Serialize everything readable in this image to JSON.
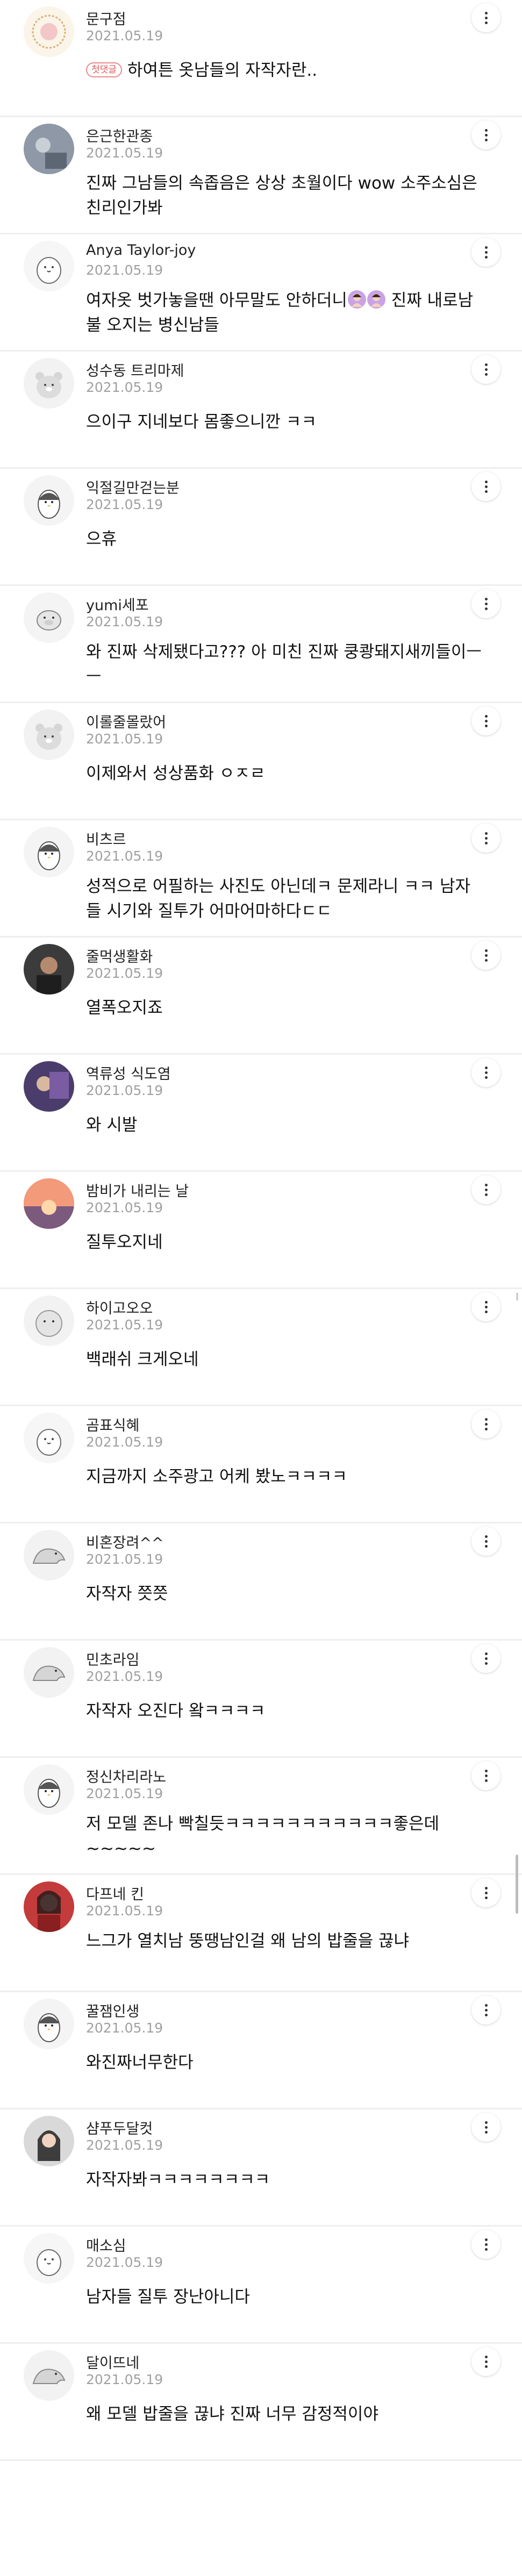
{
  "comments": [
    {
      "author": "문구점",
      "date": "2021.05.19",
      "badge": "첫댓글",
      "text": "하여튼 옷남들의 자작자란..",
      "avatar": "logo-avatar"
    },
    {
      "author": "은근한관종",
      "date": "2021.05.19",
      "text": "진짜 그남들의 속좁음은 상상 초월이다 wow 소주소심은 친리인가봐",
      "avatar": "photo-avatar"
    },
    {
      "author": "Anya Taylor-joy",
      "date": "2021.05.19",
      "text": "여자옷 벗가놓을땐 아무말도 안하더니",
      "text_after": " 진짜 내로남불 오지는 병신남들",
      "avatar": "default-avatar",
      "emoji": [
        "woman-emoji",
        "woman-emoji"
      ]
    },
    {
      "author": "성수동 트리마제",
      "date": "2021.05.19",
      "text": "으이구 지네보다 몸좋으니깐 ㅋㅋ",
      "avatar": "bear-avatar"
    },
    {
      "author": "익절길만걷는분",
      "date": "2021.05.19",
      "text": "으휴",
      "avatar": "penguin-avatar"
    },
    {
      "author": "yumi세포",
      "date": "2021.05.19",
      "text": "와 진짜 삭제됐다고??? 아 미친 진짜 쿵쾅돼지새끼들이ㅡㅡ",
      "avatar": "pig-avatar"
    },
    {
      "author": "이롤줄몰랐어",
      "date": "2021.05.19",
      "text": "이제와서 성상품화 ㅇㅈㄹ",
      "avatar": "bear-avatar"
    },
    {
      "author": "비츠르",
      "date": "2021.05.19",
      "text": "성적으로 어필하는 사진도 아닌데ㅋ 문제라니 ㅋㅋ 남자들 시기와 질투가 어마어마하다ㄷㄷ",
      "avatar": "penguin-avatar"
    },
    {
      "author": "줄먹생활화",
      "date": "2021.05.19",
      "text": "열폭오지죠",
      "avatar": "photo-avatar-dark"
    },
    {
      "author": "역류성 식도염",
      "date": "2021.05.19",
      "text": "와 시발",
      "avatar": "photo-avatar-purple"
    },
    {
      "author": "밤비가 내리는 날",
      "date": "2021.05.19",
      "text": "질투오지네",
      "avatar": "sunset-avatar"
    },
    {
      "author": "하이고오오",
      "date": "2021.05.19",
      "text": "백래쉬 크게오네",
      "avatar": "round-avatar"
    },
    {
      "author": "곰표식혜",
      "date": "2021.05.19",
      "text": "지금까지 소주광고 어케 봤노ㅋㅋㅋㅋ",
      "avatar": "default-avatar"
    },
    {
      "author": "비혼장려^^",
      "date": "2021.05.19",
      "text": "자작자 쯧쯧",
      "avatar": "dino-avatar"
    },
    {
      "author": "민초라임",
      "date": "2021.05.19",
      "text": "자작자 오진다 왘ㅋㅋㅋㅋ",
      "avatar": "dino-avatar"
    },
    {
      "author": "정신차리라노",
      "date": "2021.05.19",
      "text": "저 모델 존나 빡칠듯ㅋㅋㅋㅋㅋㅋㅋㅋㅋㅋㅋ좋은데~~~~~",
      "avatar": "penguin-avatar"
    },
    {
      "author": "다프네 킨",
      "date": "2021.05.19",
      "text": "느그가 열치남 뚱땡남인걸 왜 남의 밥줄을 끊냐",
      "avatar": "photo-avatar-red"
    },
    {
      "author": "꿀잼인생",
      "date": "2021.05.19",
      "text": "와진짜너무한다",
      "avatar": "penguin-avatar"
    },
    {
      "author": "샴푸두달컷",
      "date": "2021.05.19",
      "text": "자작자봐ㅋㅋㅋㅋㅋㅋㅋㅋ",
      "avatar": "photo-avatar-woman"
    },
    {
      "author": "매소심",
      "date": "2021.05.19",
      "text": "남자들 질투 장난아니다",
      "avatar": "default-avatar"
    },
    {
      "author": "달이뜨네",
      "date": "2021.05.19",
      "text": "왜 모델 밥줄을 끊냐 진짜 너무 감정적이야",
      "avatar": "dino-avatar"
    }
  ],
  "more_button": {
    "label": "⋮",
    "icon": "more-vertical-icon"
  },
  "colors": {
    "badge": "#e05a5a",
    "date": "#a0a0a0",
    "divider": "#eeeeee"
  }
}
